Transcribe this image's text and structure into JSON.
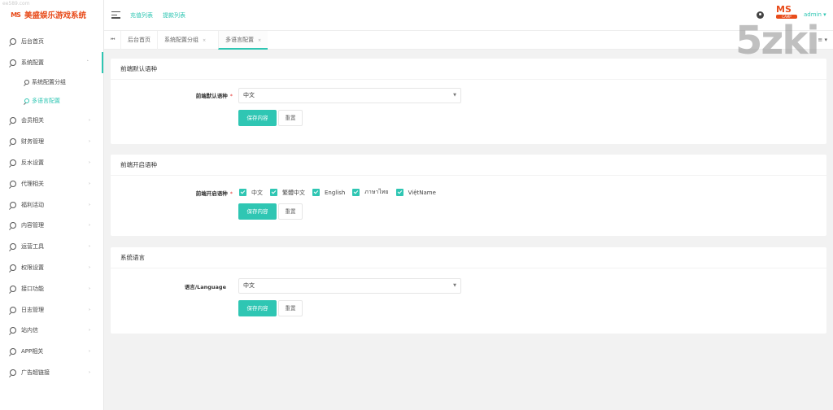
{
  "brand": {
    "watermark": "ee589.com",
    "logo_mark": "MS",
    "logo_text": "美盛娱乐游戏系统"
  },
  "sidebar": {
    "items": [
      {
        "label": "后台首页",
        "arrow": false
      },
      {
        "label": "系统配置",
        "arrow": true,
        "expanded": true
      },
      {
        "label": "会员相关",
        "arrow": true
      },
      {
        "label": "财务管理",
        "arrow": true
      },
      {
        "label": "反水设置",
        "arrow": true
      },
      {
        "label": "代理相关",
        "arrow": true
      },
      {
        "label": "福利活动",
        "arrow": true
      },
      {
        "label": "内容管理",
        "arrow": true
      },
      {
        "label": "运营工具",
        "arrow": true
      },
      {
        "label": "权限设置",
        "arrow": true
      },
      {
        "label": "接口功能",
        "arrow": true
      },
      {
        "label": "日志管理",
        "arrow": true
      },
      {
        "label": "站内信",
        "arrow": true
      },
      {
        "label": "APP相关",
        "arrow": true
      },
      {
        "label": "广告超链接",
        "arrow": true
      }
    ],
    "submenu": [
      {
        "label": "系统配置分组"
      },
      {
        "label": "多语言配置",
        "selected": true
      }
    ]
  },
  "header": {
    "links": [
      "充值列表",
      "提款列表"
    ],
    "user": "admin ▾",
    "avatar_text": "MS",
    "avatar_sub": "CAMP"
  },
  "tabs": {
    "items": [
      "后台首页",
      "系统配置分组",
      "多语言配置"
    ],
    "close": "×",
    "menu": "≡ ▾"
  },
  "overlay_watermark": "5zki",
  "cards": {
    "default_lang": {
      "title": "前端默认语种",
      "label": "前端默认语种",
      "required": "*",
      "value": "中文"
    },
    "open_lang": {
      "title": "前端开启语种",
      "label": "前端开启语种",
      "required": "*",
      "options": [
        "中文",
        "繁體中文",
        "English",
        "ภาษาไทย",
        "ViệtName"
      ]
    },
    "system_lang": {
      "title": "系统语言",
      "label": "语言/Language",
      "value": "中文"
    }
  },
  "buttons": {
    "save": "保存内容",
    "reset": "重置"
  },
  "colors": {
    "accent": "#2fc6b3",
    "brand": "#e84c1b",
    "required": "#e53935"
  }
}
